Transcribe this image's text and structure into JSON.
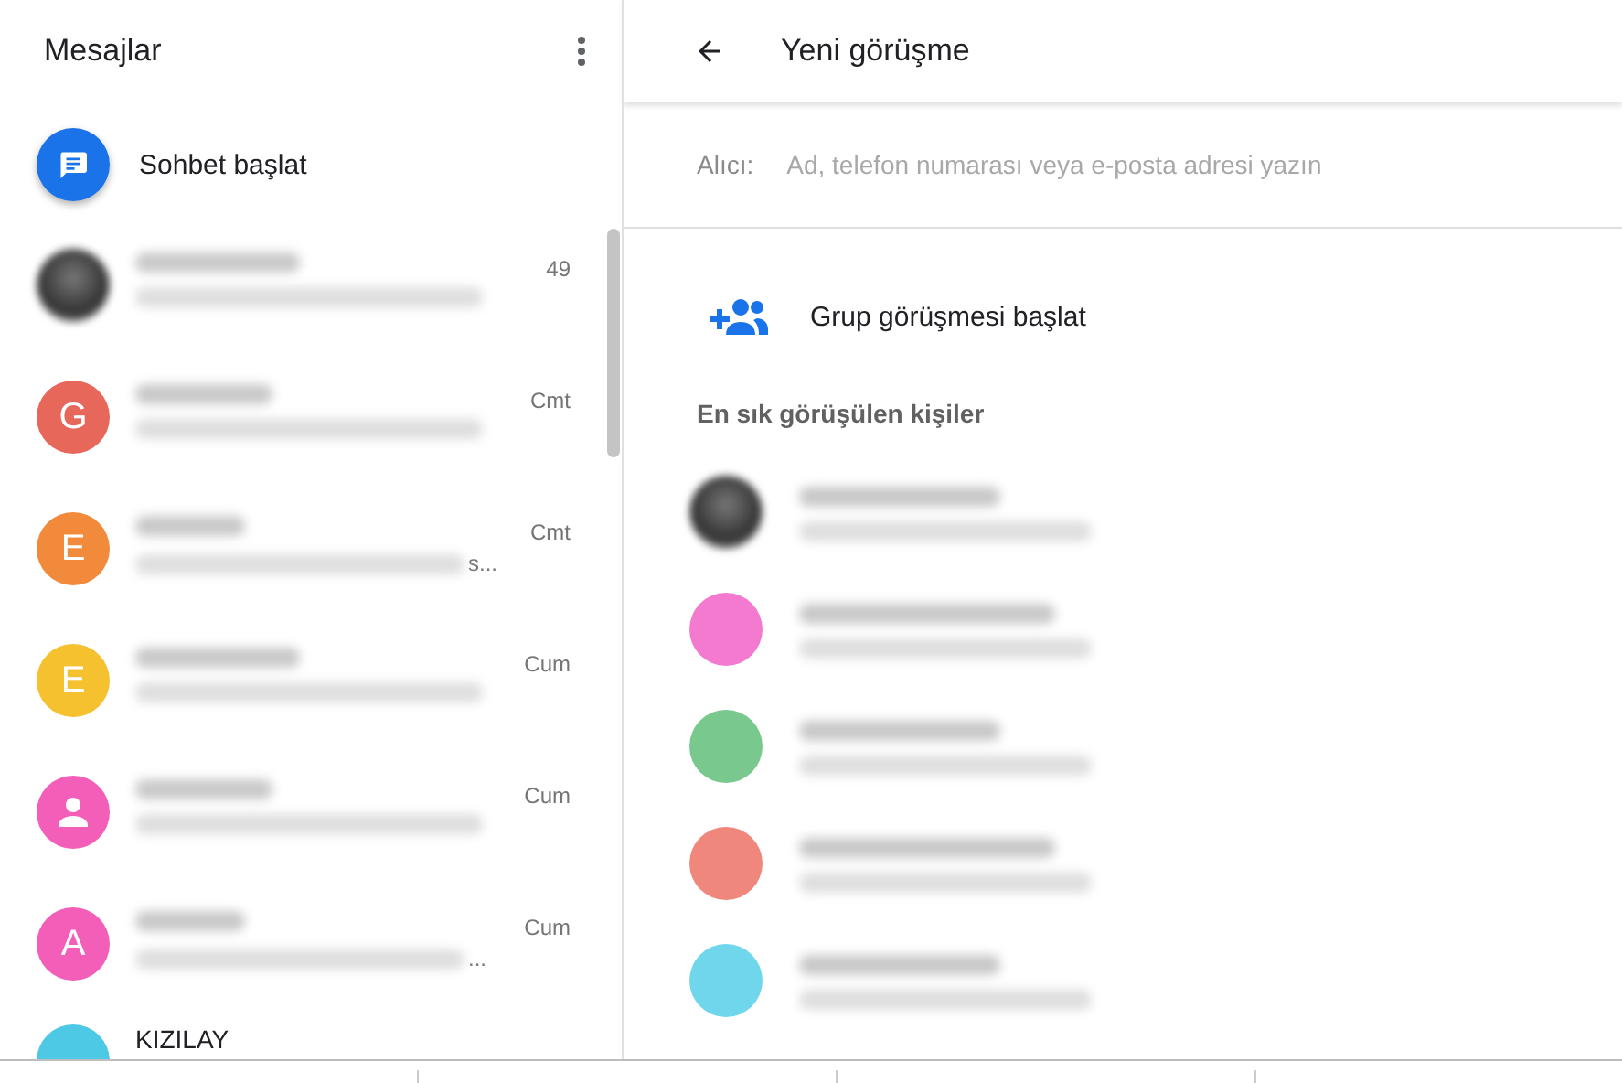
{
  "sidebar": {
    "title": "Mesajlar",
    "start_chat": {
      "label": "Sohbet başlat"
    },
    "conversations": [
      {
        "avatar": {
          "kind": "photo"
        },
        "time": "49"
      },
      {
        "avatar": {
          "kind": "letter",
          "letter": "G",
          "color": "#e8675b"
        },
        "time": "Cmt"
      },
      {
        "avatar": {
          "kind": "letter",
          "letter": "E",
          "color": "#f28a3c"
        },
        "time": "Cmt",
        "preview_tail": "s..."
      },
      {
        "avatar": {
          "kind": "letter",
          "letter": "E",
          "color": "#f6c12f"
        },
        "time": "Cum"
      },
      {
        "avatar": {
          "kind": "person",
          "color": "#f35fb8"
        },
        "time": "Cum"
      },
      {
        "avatar": {
          "kind": "letter",
          "letter": "A",
          "color": "#f35fb8"
        },
        "time": "Cum",
        "preview_tail": "..."
      },
      {
        "avatar": {
          "kind": "plain",
          "color": "#4dc9e6"
        },
        "name": "KIZILAY"
      }
    ]
  },
  "main": {
    "title": "Yeni görüşme",
    "recipient": {
      "label": "Alıcı:",
      "placeholder": "Ad, telefon numarası veya e-posta adresi yazın"
    },
    "group_chat": {
      "label": "Grup görüşmesi başlat"
    },
    "frequent": {
      "heading": "En sık görüşülen kişiler",
      "contacts": [
        {
          "avatar": {
            "kind": "photo"
          }
        },
        {
          "avatar": {
            "kind": "plain",
            "color": "#f47ad0"
          }
        },
        {
          "avatar": {
            "kind": "plain",
            "color": "#79c98e"
          }
        },
        {
          "avatar": {
            "kind": "plain",
            "color": "#f0877c"
          }
        },
        {
          "avatar": {
            "kind": "plain",
            "color": "#6fd6ec"
          }
        }
      ]
    }
  }
}
